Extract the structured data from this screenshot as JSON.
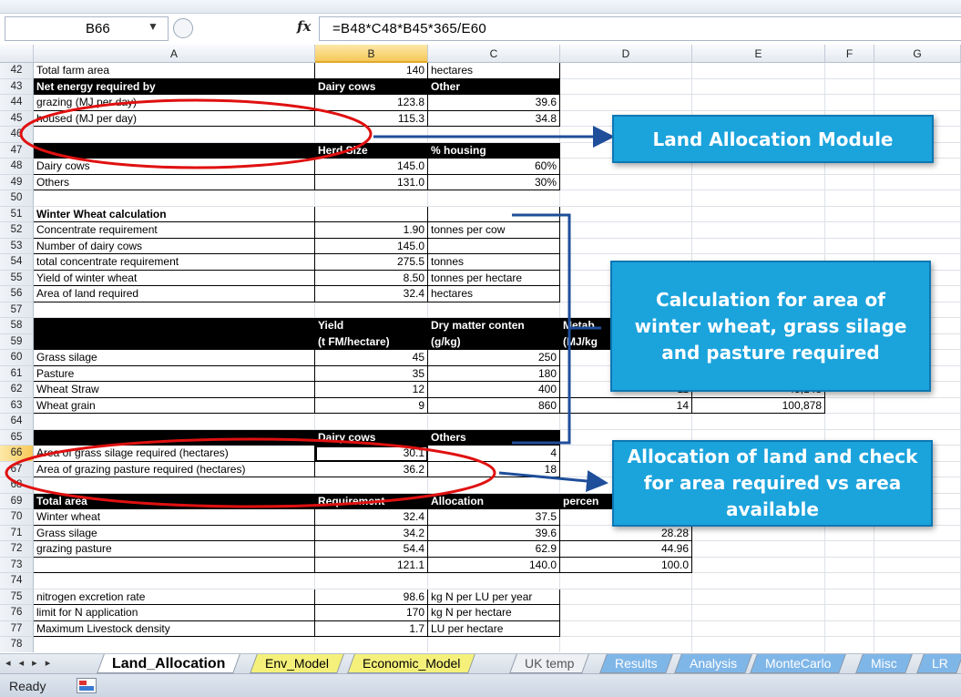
{
  "formula_bar": {
    "name_box": "B66",
    "fx_label": "fx",
    "formula": "=B48*C48*B45*365/E60"
  },
  "columns": [
    "A",
    "B",
    "C",
    "D",
    "E",
    "F",
    "G"
  ],
  "selected_column": "B",
  "rows": [
    {
      "n": "42",
      "cells": {
        "A": "Total farm area",
        "B": "140",
        "C": "hectares"
      }
    },
    {
      "n": "43",
      "style": "dark",
      "cells": {
        "A": "Net energy required by",
        "B": "Dairy cows",
        "C": "Other"
      }
    },
    {
      "n": "44",
      "cells": {
        "A": "grazing (MJ per day)",
        "B": "123.8",
        "C": "39.6"
      }
    },
    {
      "n": "45",
      "cells": {
        "A": "housed (MJ per day)",
        "B": "115.3",
        "C": "34.8"
      }
    },
    {
      "n": "46",
      "cells": {}
    },
    {
      "n": "47",
      "style": "dark",
      "cells": {
        "A": "",
        "B": "Herd Size",
        "C": "% housing"
      }
    },
    {
      "n": "48",
      "cells": {
        "A": "Dairy cows",
        "B": "145.0",
        "C": "60%"
      }
    },
    {
      "n": "49",
      "cells": {
        "A": "Others",
        "B": "131.0",
        "C": "30%"
      }
    },
    {
      "n": "50",
      "cells": {}
    },
    {
      "n": "51",
      "cells": {
        "A": "Winter Wheat calculation"
      }
    },
    {
      "n": "52",
      "cells": {
        "A": "Concentrate requirement",
        "B": "1.90",
        "C": "tonnes per cow"
      }
    },
    {
      "n": "53",
      "cells": {
        "A": "Number of dairy cows",
        "B": "145.0"
      }
    },
    {
      "n": "54",
      "cells": {
        "A": "total concentrate requirement",
        "B": "275.5",
        "C": "tonnes"
      }
    },
    {
      "n": "55",
      "cells": {
        "A": "Yield of winter wheat",
        "B": "8.50",
        "C": "tonnes per hectare"
      }
    },
    {
      "n": "56",
      "cells": {
        "A": "Area of land required",
        "B": "32.4",
        "C": "hectares"
      }
    },
    {
      "n": "57",
      "cells": {}
    },
    {
      "n": "58",
      "style": "dark",
      "cells": {
        "A": "",
        "B": "Yield",
        "C": "Dry matter conten",
        "D": "Metab"
      }
    },
    {
      "n": "59",
      "style": "dark",
      "cells": {
        "A": "",
        "B": "(t FM/hectare)",
        "C": "(g/kg)",
        "D": "(MJ/kg"
      }
    },
    {
      "n": "60",
      "cells": {
        "A": "Grass silage",
        "B": "45",
        "C": "250"
      }
    },
    {
      "n": "61",
      "cells": {
        "A": "Pasture",
        "B": "35",
        "C": "180"
      }
    },
    {
      "n": "62",
      "cells": {
        "A": "Wheat Straw",
        "B": "12",
        "C": "400",
        "D": "11",
        "E": "45,148"
      }
    },
    {
      "n": "63",
      "cells": {
        "A": "Wheat grain",
        "B": "9",
        "C": "860",
        "D": "14",
        "E": "100,878"
      }
    },
    {
      "n": "64",
      "cells": {}
    },
    {
      "n": "65",
      "style": "dark",
      "cells": {
        "A": "",
        "B": "Dairy cows",
        "C": "Others"
      }
    },
    {
      "n": "66",
      "cells": {
        "A": "Area of grass silage required (hectares)",
        "B": "30.1",
        "C": "4"
      }
    },
    {
      "n": "67",
      "cells": {
        "A": "Area of grazing pasture required (hectares)",
        "B": "36.2",
        "C": "18"
      }
    },
    {
      "n": "68",
      "cells": {}
    },
    {
      "n": "69",
      "style": "dark",
      "cells": {
        "A": "Total area",
        "B": "Requirement",
        "C": "Allocation",
        "D": "percen"
      }
    },
    {
      "n": "70",
      "cells": {
        "A": "Winter wheat",
        "B": "32.4",
        "C": "37.5"
      }
    },
    {
      "n": "71",
      "cells": {
        "A": "Grass silage",
        "B": "34.2",
        "C": "39.6",
        "D": "28.28"
      }
    },
    {
      "n": "72",
      "cells": {
        "A": "grazing pasture",
        "B": "54.4",
        "C": "62.9",
        "D": "44.96"
      }
    },
    {
      "n": "73",
      "cells": {
        "A": "",
        "B": "121.1",
        "C": "140.0",
        "D": "100.0"
      }
    },
    {
      "n": "74",
      "cells": {}
    },
    {
      "n": "75",
      "cells": {
        "A": "nitrogen excretion rate",
        "B": "98.6",
        "C": "kg N per LU per year"
      }
    },
    {
      "n": "76",
      "cells": {
        "A": "limit for N application",
        "B": "170",
        "C": "kg N per hectare"
      }
    },
    {
      "n": "77",
      "cells": {
        "A": "Maximum Livestock density",
        "B": "1.7",
        "C": "LU per hectare"
      }
    },
    {
      "n": "78",
      "cells": {}
    }
  ],
  "callouts": {
    "land_allocation": "Land Allocation Module",
    "calculation": "Calculation for area of winter wheat, grass silage and pasture required",
    "allocation_check": "Allocation of land and check for area required vs area available"
  },
  "sheet_tabs": [
    {
      "label": "Land_Allocation",
      "style": "active"
    },
    {
      "label": "Env_Model",
      "style": "yellow"
    },
    {
      "label": "Economic_Model",
      "style": "yellow"
    },
    {
      "label": "UK temp",
      "style": "gray"
    },
    {
      "label": "Results",
      "style": "blue"
    },
    {
      "label": "Analysis",
      "style": "blue"
    },
    {
      "label": "MonteCarlo",
      "style": "blue"
    },
    {
      "label": "Misc",
      "style": "blue"
    },
    {
      "label": "LR",
      "style": "blue"
    }
  ],
  "tab_nav": "◂ ◂ ▸ ▸",
  "status": {
    "text": "Ready"
  },
  "colors": {
    "callout_fill": "#1ba3dc",
    "callout_border": "#0d77b3",
    "ellipse": "#e01010",
    "arrow": "#1f4e9a",
    "selection": "#f6c95a"
  }
}
